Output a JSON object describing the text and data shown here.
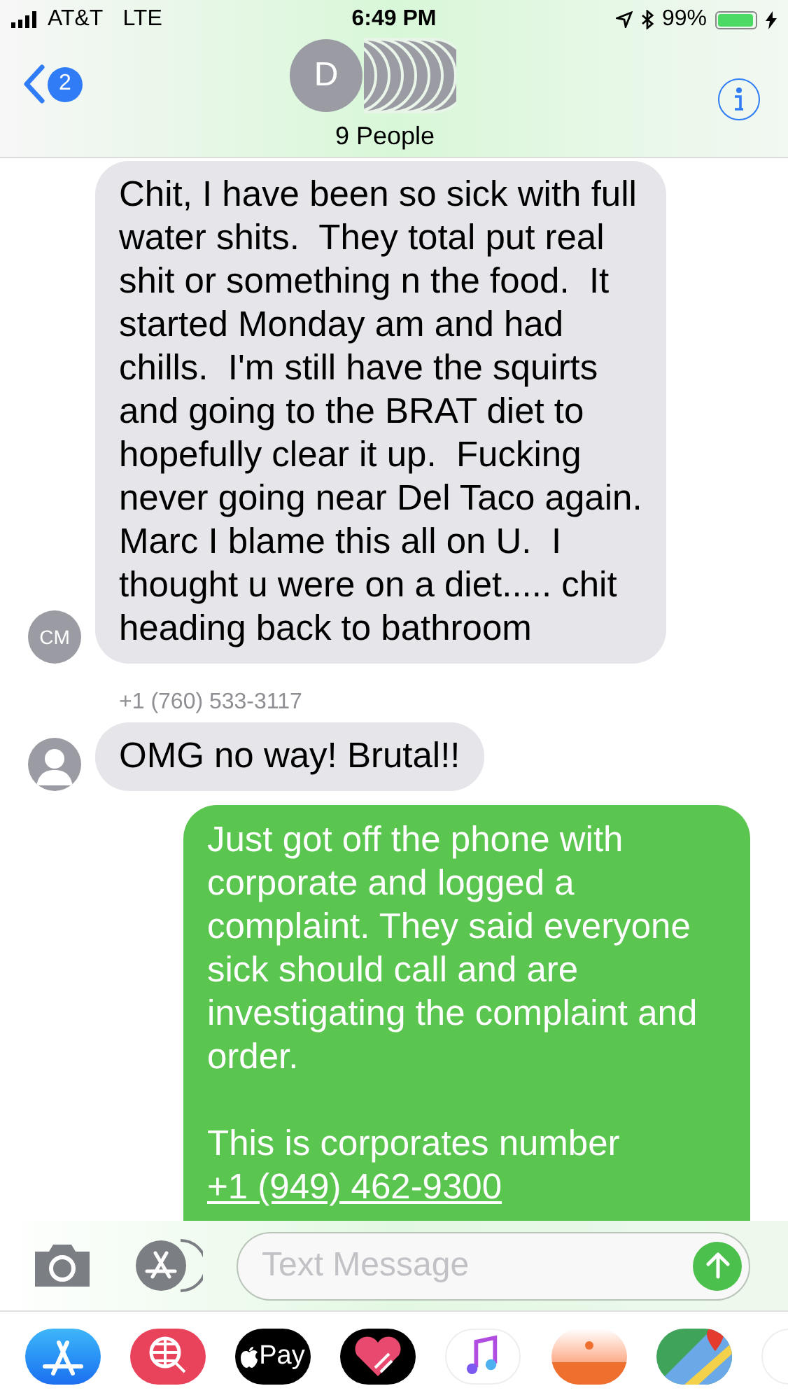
{
  "status_bar": {
    "carrier": "AT&T",
    "network": "LTE",
    "time": "6:49 PM",
    "battery": "99%"
  },
  "nav": {
    "back_badge": "2",
    "avatar_initial": "D",
    "group_name": "9 People"
  },
  "messages": [
    {
      "kind": "received",
      "avatar": "CM",
      "paragraphs": [
        {
          "kind": "text",
          "text": "Chit, I have been so sick with full water shits.  They total put real shit or something n the food.  It started Monday am and had chills.  I'm still have the squirts and going to the BRAT diet to hopefully clear it up.  Fucking never going near Del Taco again.  Marc I blame this all on U.  I thought u were on a diet..... chit heading back to bathroom"
        }
      ]
    },
    {
      "kind": "received",
      "sender": "+1 (760) 533-3117",
      "paragraphs": [
        {
          "kind": "text",
          "text": "OMG no way! Brutal!!"
        }
      ]
    },
    {
      "kind": "sent",
      "paragraphs": [
        {
          "kind": "text",
          "text": "Just got off the phone with corporate and logged a complaint. They said everyone sick should call and are investigating the complaint and order."
        },
        {
          "kind": "text",
          "text": "This is corporates number"
        },
        {
          "kind": "link",
          "text": "+1 (949) 462-9300"
        }
      ]
    }
  ],
  "composer": {
    "placeholder": "Text Message"
  },
  "apps": [
    {
      "kind": "store"
    },
    {
      "kind": "search"
    },
    {
      "kind": "pay",
      "label": "Pay"
    },
    {
      "kind": "heart"
    },
    {
      "kind": "music"
    },
    {
      "kind": "card"
    },
    {
      "kind": "maps"
    },
    {
      "kind": "partial"
    }
  ]
}
